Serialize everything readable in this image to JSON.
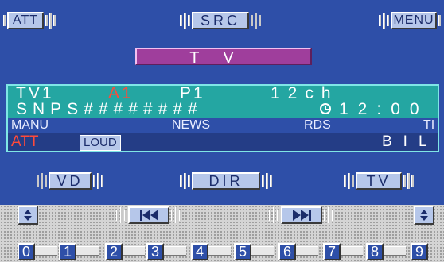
{
  "top_keys": {
    "att": "ATT",
    "src": "SRC",
    "menu": "MENU"
  },
  "title_bar": "TV",
  "info": {
    "row1": {
      "source": "TV1",
      "band": "A1",
      "preset": "P1",
      "channel": "12ch"
    },
    "row2": {
      "name": "SNPS########",
      "clock_icon": "clock-icon",
      "time": "12:00"
    },
    "row3": {
      "manu": "MANU",
      "news": "NEWS",
      "rds": "RDS",
      "ti": "TI"
    },
    "row4": {
      "att": "ATT",
      "loud": "LOUD",
      "bil": "BIL"
    }
  },
  "mid_keys": {
    "vd": "VD",
    "dir": "DIR",
    "tv": "TV"
  },
  "transport": {
    "left_toggle_icon": "up-down-icon",
    "prev_icon": "skip-back-icon",
    "next_icon": "skip-forward-icon",
    "right_toggle_icon": "up-down-icon"
  },
  "presets": [
    "0",
    "1",
    "2",
    "3",
    "4",
    "5",
    "6",
    "7",
    "8",
    "9"
  ],
  "colors": {
    "background": "#2e4fa8",
    "display_teal": "#24a6a2",
    "title_magenta": "#9f3e9c",
    "alert_red": "#ff4a3a",
    "key_face": "#b6c7ea"
  }
}
